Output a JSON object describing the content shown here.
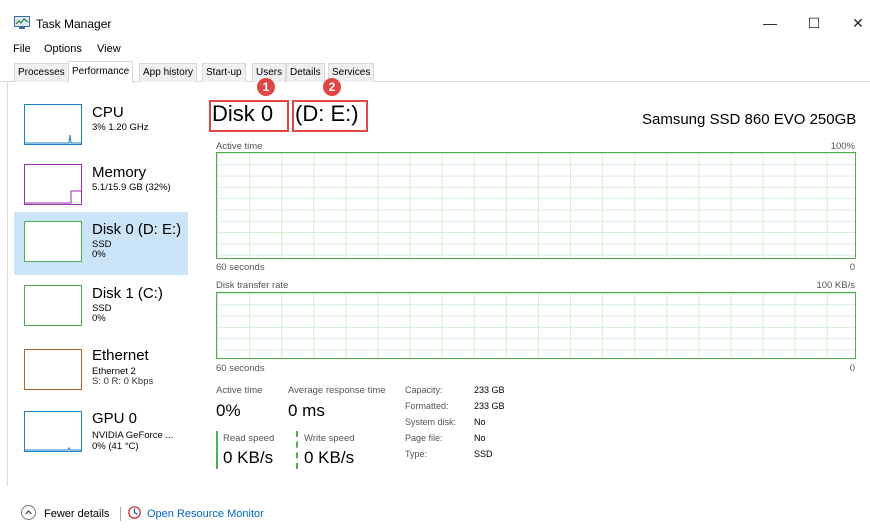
{
  "window": {
    "title": "Task Manager",
    "minimize": "—",
    "maximize": "☐",
    "close": "✕"
  },
  "menu": [
    "File",
    "Options",
    "View"
  ],
  "tabs": [
    "Processes",
    "Performance",
    "App history",
    "Start-up",
    "Users",
    "Details",
    "Services"
  ],
  "active_tab": "Performance",
  "sidebar": [
    {
      "name": "CPU",
      "line1": "3% 1.20 GHz",
      "line2": "",
      "color": "#1a7fc7"
    },
    {
      "name": "Memory",
      "line1": "5.1/15.9 GB (32%)",
      "line2": "",
      "color": "#9b2fae"
    },
    {
      "name": "Disk 0 (D: E:)",
      "line1": "SSD",
      "line2": "0%",
      "color": "#4caf50",
      "selected": true
    },
    {
      "name": "Disk 1 (C:)",
      "line1": "SSD",
      "line2": "0%",
      "color": "#4caf50"
    },
    {
      "name": "Ethernet",
      "line1": "Ethernet 2",
      "line2": "S: 0 R: 0 Kbps",
      "color": "#b06428"
    },
    {
      "name": "GPU 0",
      "line1": "NVIDIA GeForce ...",
      "line2": "0% (41 °C)",
      "color": "#1a7fc7"
    }
  ],
  "detail": {
    "disk_label": "Disk 0",
    "disk_drives": "(D: E:)",
    "model": "Samsung SSD 860 EVO 250GB",
    "graph1": {
      "label": "Active time",
      "max": "100%",
      "time": "60 seconds",
      "min": "0"
    },
    "graph2": {
      "label": "Disk transfer rate",
      "max": "100 KB/s",
      "time": "60 seconds",
      "min": "0"
    },
    "stats": {
      "active_time_label": "Active time",
      "active_time_value": "0%",
      "avg_response_label": "Average response time",
      "avg_response_value": "0 ms",
      "read_speed_label": "Read speed",
      "read_speed_value": "0 KB/s",
      "write_speed_label": "Write speed",
      "write_speed_value": "0 KB/s"
    },
    "properties": [
      {
        "label": "Capacity:",
        "value": "233 GB"
      },
      {
        "label": "Formatted:",
        "value": "233 GB"
      },
      {
        "label": "System disk:",
        "value": "No"
      },
      {
        "label": "Page file:",
        "value": "No"
      },
      {
        "label": "Type:",
        "value": "SSD"
      }
    ]
  },
  "annotations": [
    "1",
    "2"
  ],
  "footer": {
    "fewer_details": "Fewer details",
    "open_resource_monitor": "Open Resource Monitor"
  },
  "colors": {
    "accent_green": "#4caf50",
    "selection": "#cce4f7",
    "annotation_red": "#e04646",
    "link": "#0066cc"
  }
}
